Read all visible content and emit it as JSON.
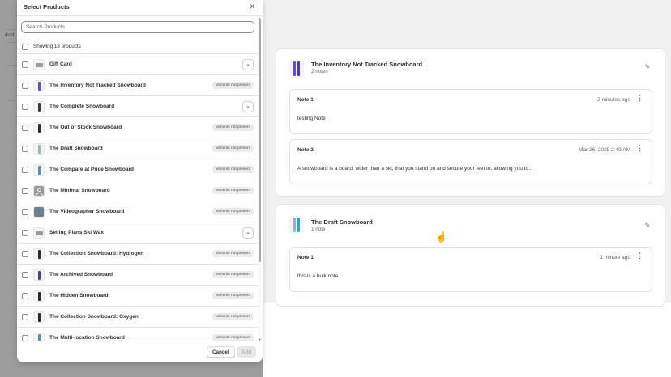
{
  "modal": {
    "title": "Select Products",
    "close_icon": "close-icon",
    "search_placeholder": "Search Products",
    "showing_text": "Showing 18 products",
    "rows": [
      {
        "label": "Gift Card",
        "type": "expand",
        "thumb": "gift-card-icon"
      },
      {
        "label": "The Inventory Not Tracked Snowboard",
        "type": "badge",
        "badge": "Variants not present",
        "board": "#6a4cc8"
      },
      {
        "label": "The Complete Snowboard",
        "type": "expand",
        "board": "#3b3b3b"
      },
      {
        "label": "The Out of Stock Snowboard",
        "type": "badge",
        "badge": "Variants not present",
        "board": "#2c2c2c"
      },
      {
        "label": "The Draft Snowboard",
        "type": "badge",
        "badge": "Variants not present",
        "board": "#8fb8c9"
      },
      {
        "label": "The Compare at Price Snowboard",
        "type": "badge",
        "badge": "Variants not present",
        "board": "#3aa0b8"
      },
      {
        "label": "The Minimal Snowboard",
        "type": "badge",
        "badge": "Variants not present",
        "thumb": "placeholder-image-icon"
      },
      {
        "label": "The Videographer Snowboard",
        "type": "badge",
        "badge": "Variants not present",
        "thumb": "photo-icon"
      },
      {
        "label": "Selling Plans Ski Wax",
        "type": "expand",
        "thumb": "wax-icon"
      },
      {
        "label": "The Collection Snowboard: Hydrogen",
        "type": "badge",
        "badge": "Variants not present",
        "board": "#2c2c2c"
      },
      {
        "label": "The Archived Snowboard",
        "type": "badge",
        "badge": "Variants not present",
        "board": "#4c3ab8"
      },
      {
        "label": "The Hidden Snowboard",
        "type": "badge",
        "badge": "Variants not present",
        "board": "#2c2c2c"
      },
      {
        "label": "The Collection Snowboard: Oxygen",
        "type": "badge",
        "badge": "Variants not present",
        "board": "#2c2c2c"
      },
      {
        "label": "The Multi-location Snowboard",
        "type": "badge",
        "badge": "Variants not present",
        "board": "#3aa0b8"
      }
    ],
    "cancel_label": "Cancel",
    "add_label": "Add"
  },
  "background": {
    "left_fragment": "duct",
    "products": [
      {
        "title": "The Inventory Not Tracked Snowboard",
        "count": "2 notes",
        "notes": [
          {
            "title": "Note 1",
            "time": "2 minutes ago",
            "body": "testing Note"
          },
          {
            "title": "Note 2",
            "time": "Mar 26, 2025 2:49 AM",
            "body": "A snowboard is a board, wider than a ski, that you stand on and secure your feet to, allowing you to..."
          }
        ]
      },
      {
        "title": "The Draft Snowboard",
        "count": "1 note",
        "notes": [
          {
            "title": "Note 1",
            "time": "1 minute ago",
            "body": "this is a bulk note"
          }
        ]
      }
    ]
  },
  "colors": {
    "accent_purple": "#6a4cc8",
    "border": "#e3e3e3",
    "text": "#303030"
  }
}
